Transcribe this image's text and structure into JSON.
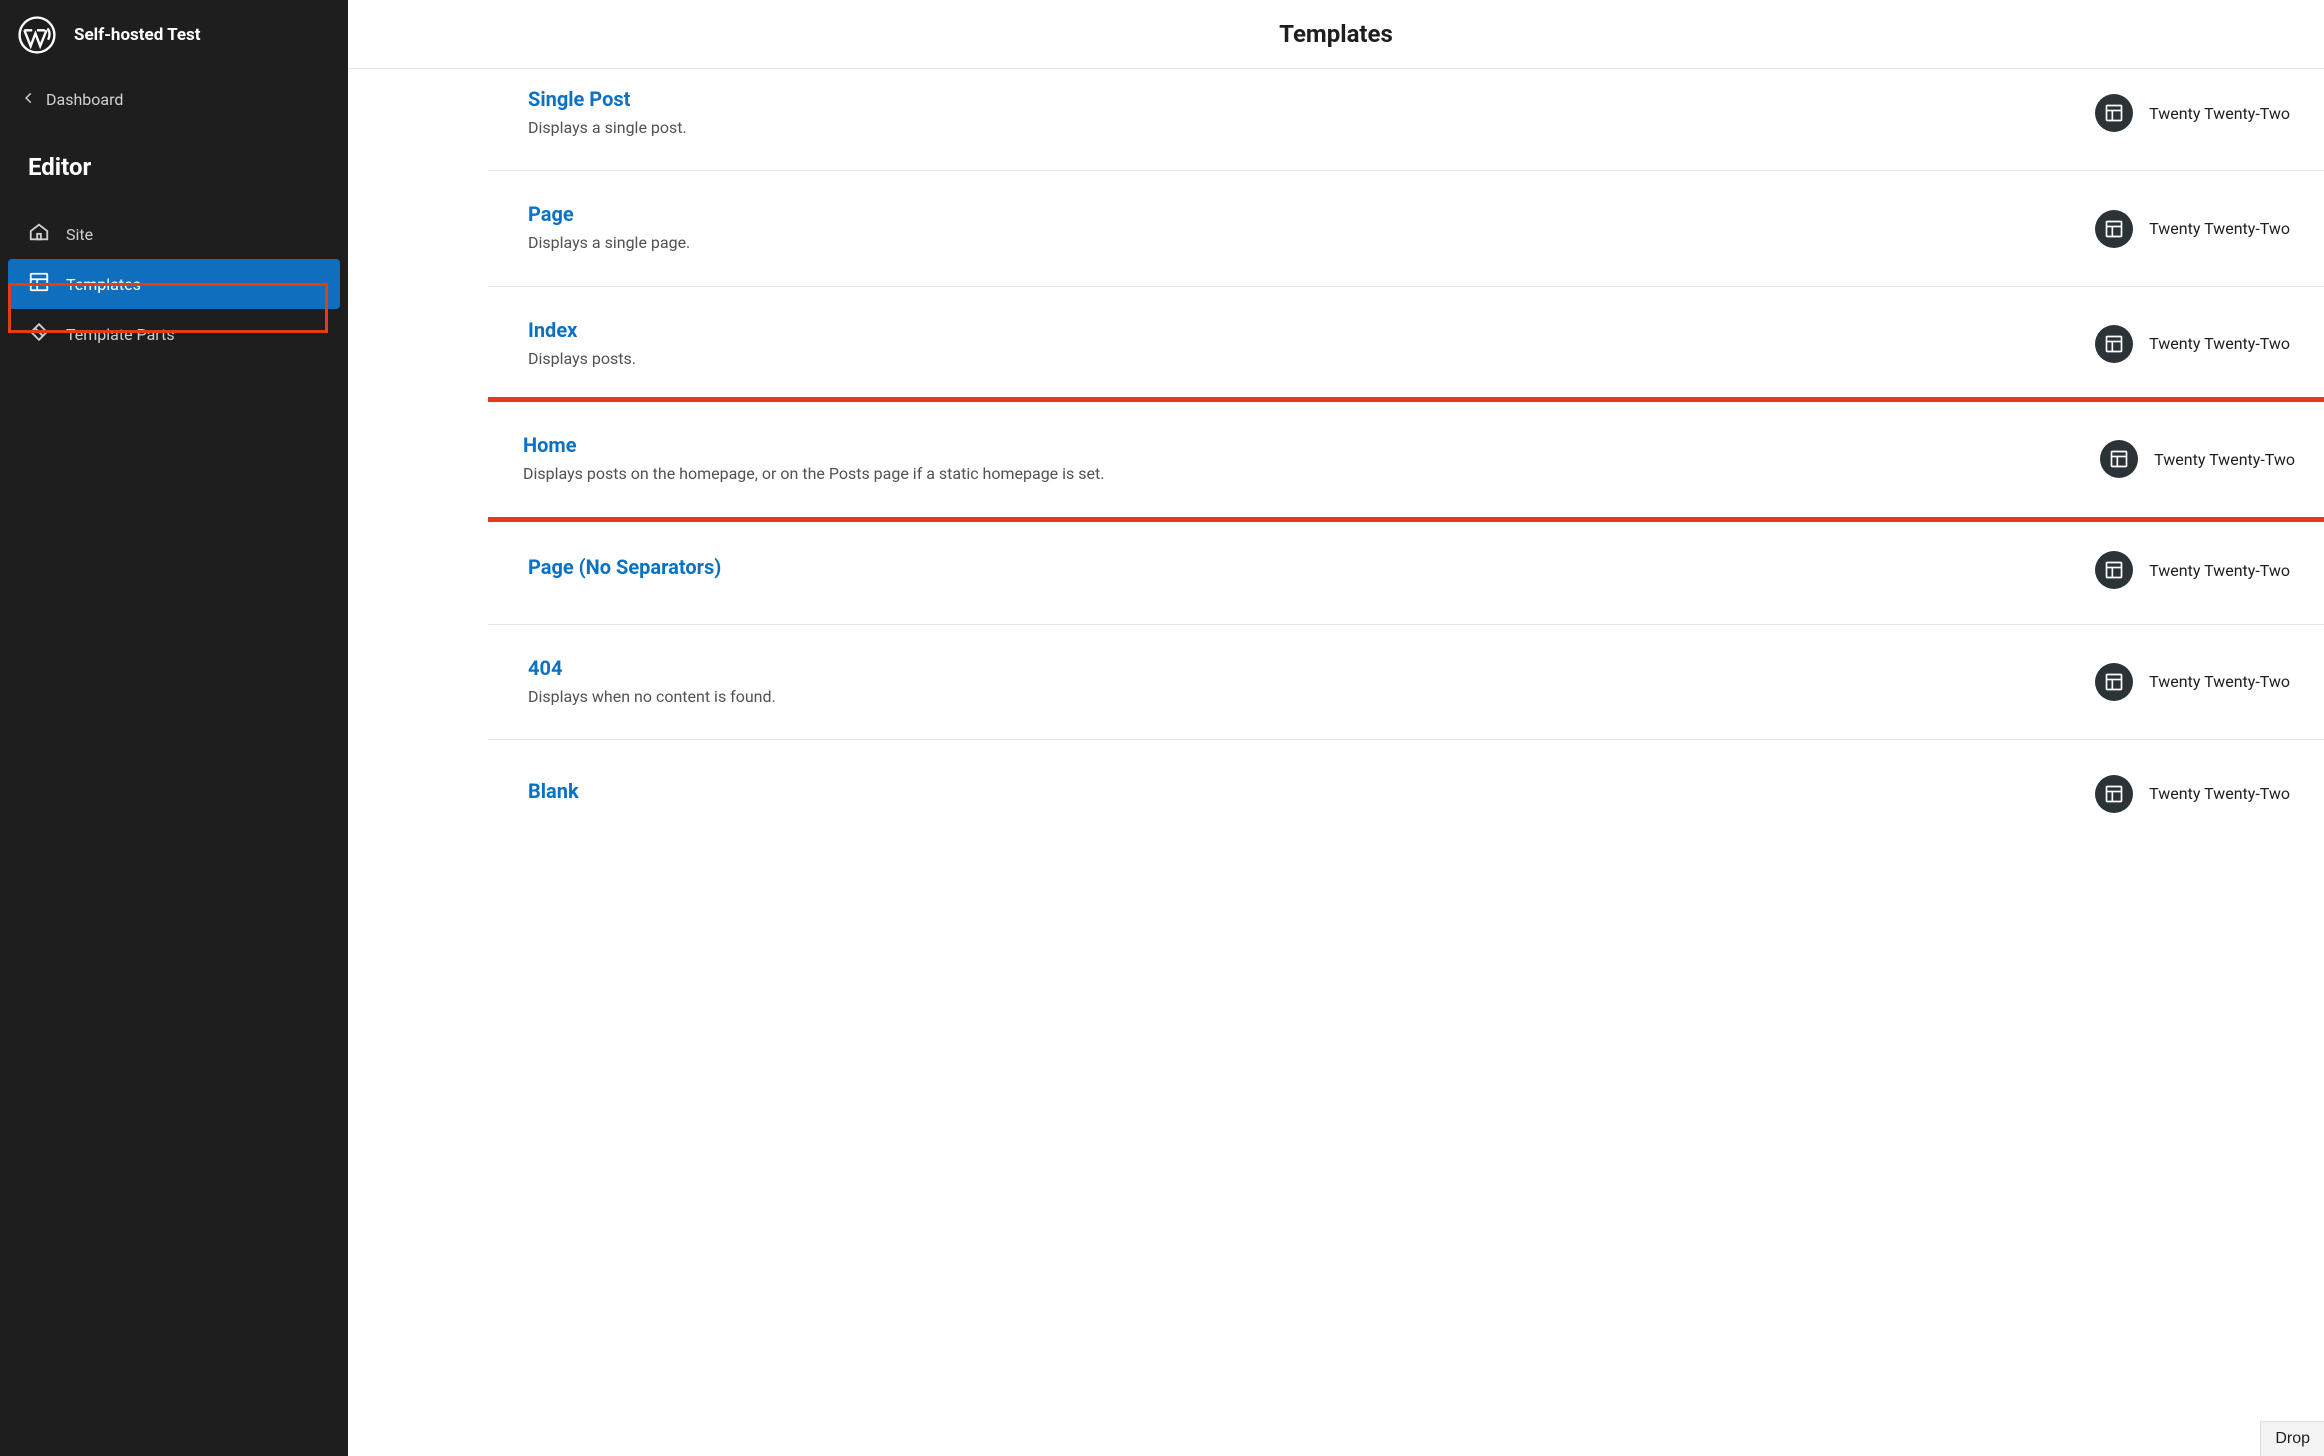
{
  "site_title": "Self-hosted Test",
  "back_label": "Dashboard",
  "section_label": "Editor",
  "nav": {
    "site": "Site",
    "templates": "Templates",
    "template_parts": "Template Parts"
  },
  "page_title": "Templates",
  "theme_name": "Twenty Twenty-Two",
  "templates": [
    {
      "title": "Single Post",
      "description": "Displays a single post."
    },
    {
      "title": "Page",
      "description": "Displays a single page."
    },
    {
      "title": "Index",
      "description": "Displays posts."
    },
    {
      "title": "Home",
      "description": "Displays posts on the homepage, or on the Posts page if a static homepage is set.",
      "highlighted": true
    },
    {
      "title": "Page (No Separators)",
      "description": ""
    },
    {
      "title": "404",
      "description": "Displays when no content is found."
    },
    {
      "title": "Blank",
      "description": ""
    }
  ],
  "drop_label": "Drop"
}
